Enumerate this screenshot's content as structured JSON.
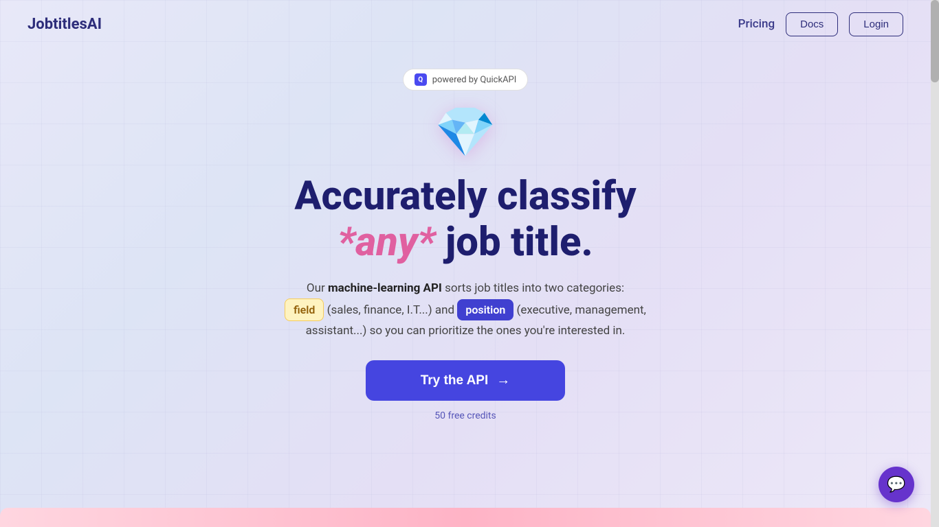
{
  "nav": {
    "logo": "JobtitlesAI",
    "links": {
      "pricing": "Pricing",
      "docs": "Docs",
      "login": "Login"
    }
  },
  "powered_badge": {
    "icon_label": "Q",
    "text": "powered by QuickAPI"
  },
  "diamond": {
    "emoji": "💎"
  },
  "hero": {
    "line1": "Accurately classify",
    "line2_prefix": "",
    "any_text": "*any*",
    "line2_suffix": " job title.",
    "description_before": "Our ",
    "description_bold": "machine-learning API",
    "description_mid": " sorts job titles into two categories:",
    "field_badge": "field",
    "description_and": " (sales, finance, I.T...) and ",
    "position_badge": "position",
    "description_after": " (executive, management, assistant...) so you can prioritize the ones you're interested in."
  },
  "cta": {
    "button_label": "Try the API",
    "arrow": "→",
    "free_credits": "50 free credits"
  }
}
